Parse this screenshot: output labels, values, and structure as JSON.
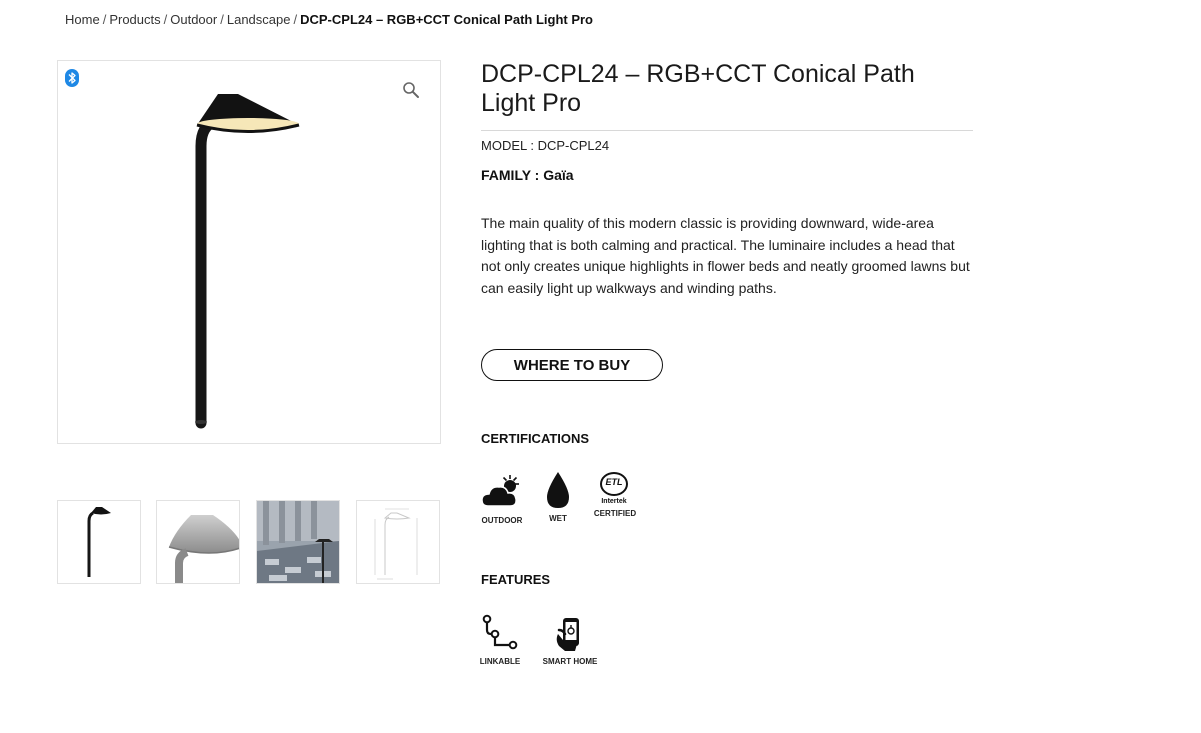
{
  "breadcrumb": {
    "items": [
      "Home",
      "Products",
      "Outdoor",
      "Landscape"
    ],
    "separator": "/",
    "current": "DCP-CPL24 – RGB+CCT Conical Path Light Pro"
  },
  "product": {
    "title": "DCP-CPL24 – RGB+CCT Conical Path Light Pro",
    "model": "MODEL : DCP-CPL24",
    "family": "FAMILY : Gaïa",
    "description": "The main quality of this modern classic is providing downward, wide-area lighting that is both calming and practical. The luminaire includes a head that not only creates unique highlights in flower beds and neatly groomed lawns but can easily light up walkways and winding paths.",
    "buy_label": "WHERE TO BUY"
  },
  "gallery": {
    "icons": [
      "bluetooth-icon",
      "zoom-icon"
    ],
    "thumbnails": [
      "product-front",
      "product-head-closeup",
      "installed-walkway",
      "dimension-drawing"
    ]
  },
  "certifications": {
    "title": "CERTIFICATIONS",
    "items": [
      {
        "label": "OUTDOOR",
        "icon": "cloud-sun-icon"
      },
      {
        "label": "WET",
        "icon": "water-drop-icon"
      },
      {
        "label": "CERTIFIED",
        "icon": "etl-intertek-icon",
        "mark_text": "ETL",
        "sub_text": "Intertek"
      }
    ]
  },
  "features": {
    "title": "FEATURES",
    "items": [
      {
        "label": "LINKABLE",
        "icon": "linkable-icon"
      },
      {
        "label": "SMART HOME",
        "icon": "smartphone-hand-icon"
      }
    ]
  },
  "colors": {
    "text": "#1a1a1a",
    "border": "#e2e2e2",
    "bluetooth": "#1e88e5",
    "warm_light": "#f6e7b8"
  }
}
